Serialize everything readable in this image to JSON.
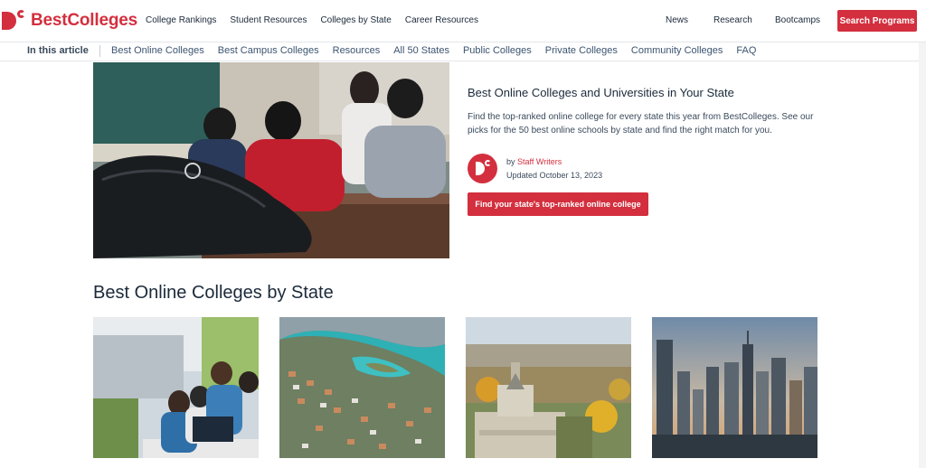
{
  "brand": {
    "name": "BestColleges",
    "color": "#d32f3e"
  },
  "nav": {
    "main_links": [
      "College Rankings",
      "Student Resources",
      "Colleges by State",
      "Career Resources"
    ],
    "right_links": [
      "News",
      "Research",
      "Bootcamps"
    ],
    "search_button": "Search Programs"
  },
  "article_nav": {
    "label": "In this article",
    "links": [
      "Best Online Colleges",
      "Best Campus Colleges",
      "Resources",
      "All 50 States",
      "Public Colleges",
      "Private Colleges",
      "Community Colleges",
      "FAQ"
    ]
  },
  "hero": {
    "title": "Best Online Colleges and Universities in Your State",
    "description": "Find the top-ranked online college for every state this year from BestColleges. See our picks for the 50 best online schools by state and find the right match for you.",
    "by_prefix": "by",
    "author": "Staff Writers",
    "updated": "Updated October 13, 2023",
    "cta": "Find your state's top-ranked online college"
  },
  "section": {
    "title": "Best Online Colleges by State"
  },
  "cards": [
    {
      "icon": "students-photo"
    },
    {
      "icon": "coastal-city-photo"
    },
    {
      "icon": "capitol-photo"
    },
    {
      "icon": "skyline-photo"
    }
  ]
}
